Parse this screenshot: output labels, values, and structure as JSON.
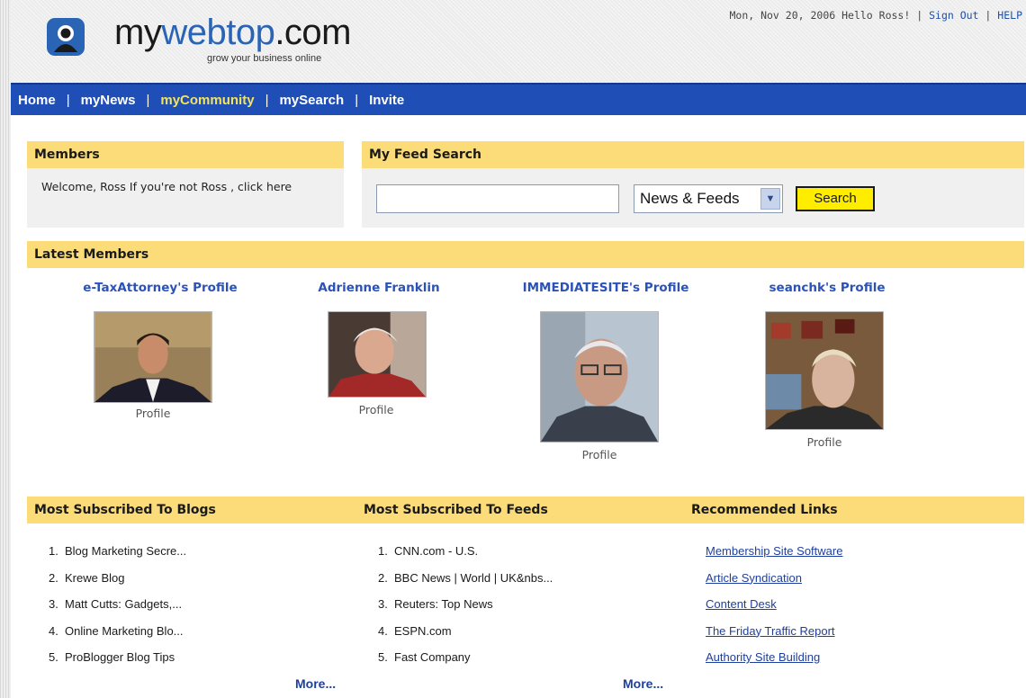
{
  "header": {
    "logo_prefix": "my",
    "logo_accent": "webtop",
    "logo_suffix": ".com",
    "tagline": "grow your business online",
    "date": "Mon, Nov 20, 2006",
    "greeting": "Hello Ross!",
    "sign_out": "Sign Out",
    "help": "HELP"
  },
  "nav": {
    "items": [
      "Home",
      "myNews",
      "myCommunity",
      "mySearch",
      "Invite"
    ],
    "active": "myCommunity"
  },
  "members_panel": {
    "title": "Members",
    "welcome": "Welcome, Ross If you're not Ross , click here"
  },
  "feed_search": {
    "title": "My Feed Search",
    "input_value": "",
    "select_value": "News & Feeds",
    "button_label": "Search"
  },
  "latest_members": {
    "title": "Latest Members",
    "members": [
      {
        "name": "e-TaxAttorney's Profile",
        "caption": "Profile"
      },
      {
        "name": "Adrienne Franklin",
        "caption": "Profile"
      },
      {
        "name": "IMMEDIATESITE's Profile",
        "caption": "Profile"
      },
      {
        "name": "seanchk's Profile",
        "caption": "Profile"
      }
    ]
  },
  "blogs": {
    "title": "Most Subscribed To Blogs",
    "items": [
      "Blog Marketing Secre...",
      "Krewe Blog",
      "Matt Cutts: Gadgets,...",
      "Online Marketing Blo...",
      "ProBlogger Blog Tips"
    ],
    "more": "More..."
  },
  "feeds": {
    "title": "Most Subscribed To Feeds",
    "items": [
      "CNN.com - U.S.",
      "BBC News | World | UK&nbs...",
      "Reuters: Top News",
      "ESPN.com",
      "Fast Company"
    ],
    "more": "More..."
  },
  "links": {
    "title": "Recommended Links",
    "items": [
      "Membership Site Software",
      "Article Syndication",
      "Content Desk",
      "The Friday Traffic Report",
      "Authority Site Building"
    ]
  },
  "colors": {
    "nav_bg": "#1f4fb6",
    "nav_active": "#f4e45a",
    "panel_bar": "#fbdc78",
    "link": "#1f3f9c",
    "button": "#ffed00"
  }
}
